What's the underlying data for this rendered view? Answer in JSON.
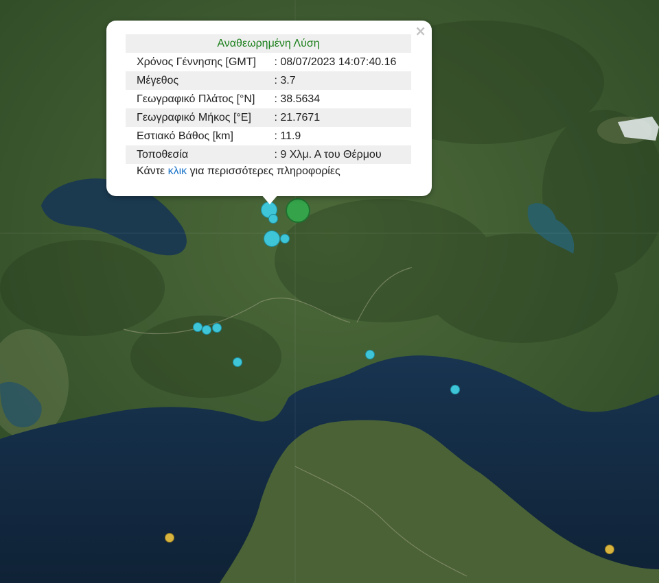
{
  "popup": {
    "title": "Αναθεωρημένη Λύση",
    "close": "×",
    "rows": [
      {
        "label": "Χρόνος Γέννησης [GMT]",
        "value": ": 08/07/2023 14:07:40.16"
      },
      {
        "label": "Μέγεθος",
        "value": ": 3.7"
      },
      {
        "label": "Γεωγραφικό Πλάτος [°N]",
        "value": ": 38.5634"
      },
      {
        "label": "Γεωγραφικό Μήκος [°E]",
        "value": ": 21.7671"
      },
      {
        "label": "Εστιακό Βάθος [km]",
        "value": ": 11.9"
      },
      {
        "label": "Τοποθεσία",
        "value": ": 9 Χλμ. Α του Θέρμου"
      }
    ],
    "more_prefix": "Κάντε ",
    "more_link": "κλικ",
    "more_suffix": " για περισσότερες πληροφορίες"
  },
  "colors": {
    "recent_marker": "#3ec6d8",
    "selected_marker": "#35a34a",
    "older_marker": "#d8b43e",
    "sea": "#14283e",
    "land": "#3e5a30"
  }
}
